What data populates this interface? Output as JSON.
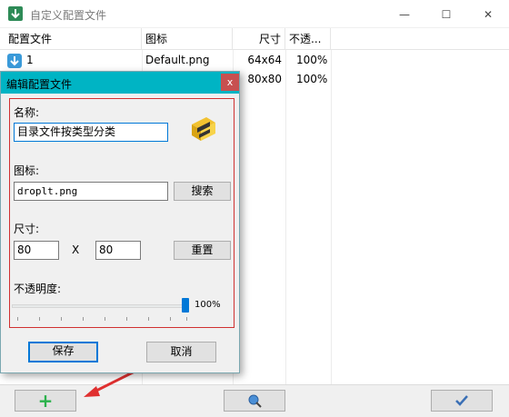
{
  "window": {
    "title": "自定义配置文件",
    "controls": {
      "minimize": "—",
      "maximize": "☐",
      "close": "✕"
    }
  },
  "list": {
    "columns": [
      "配置文件",
      "图标",
      "尺寸",
      "不透..."
    ],
    "rows": [
      {
        "name": "1",
        "icon_file": "Default.png",
        "size": "64x64",
        "opacity": "100%"
      },
      {
        "name": "",
        "icon_file": "",
        "size": "80x80",
        "opacity": "100%"
      }
    ]
  },
  "dialog": {
    "title": "编辑配置文件",
    "close": "x",
    "name_label": "名称:",
    "name_value": "目录文件按类型分类",
    "icon_label": "图标:",
    "icon_value": "droplt.png",
    "search_button": "搜索",
    "size_label": "尺寸:",
    "width_value": "80",
    "times": "X",
    "height_value": "80",
    "reset_button": "重置",
    "opacity_label": "不透明度:",
    "opacity_value": "100%",
    "opacity_level": 1.0,
    "save_button": "保存",
    "cancel_button": "取消"
  },
  "bottom": {
    "add_label": "+",
    "accent_green": "#2bb24c"
  }
}
